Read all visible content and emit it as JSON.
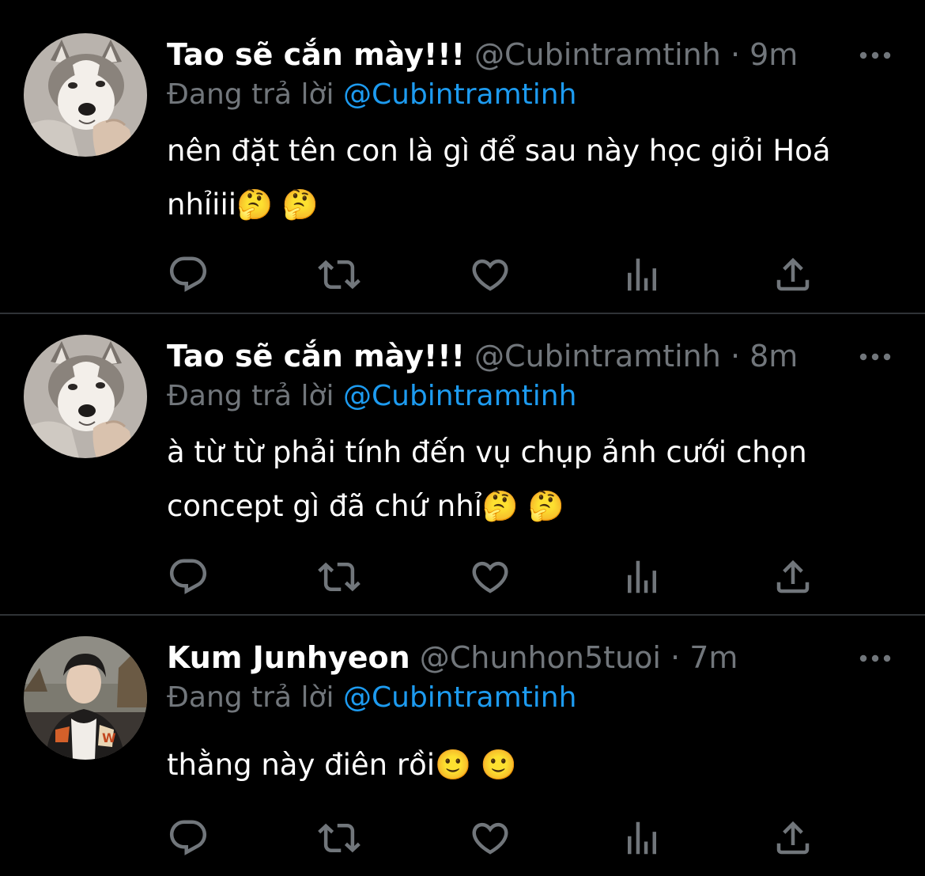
{
  "tweets": [
    {
      "display_name": "Tao sẽ cắn mày!!!",
      "handle": "@Cubintramtinh",
      "separator": "·",
      "time": "9m",
      "reply_prefix": "Đang trả lời",
      "reply_to": "@Cubintramtinh",
      "text": "nên đặt tên con là gì để sau này học giỏi Hoá nhỉiii🤔 🤔",
      "avatar_icon": "husky-dog-avatar-icon"
    },
    {
      "display_name": "Tao sẽ cắn mày!!!",
      "handle": "@Cubintramtinh",
      "separator": "·",
      "time": "8m",
      "reply_prefix": "Đang trả lời",
      "reply_to": "@Cubintramtinh",
      "text": "à từ từ phải tính đến vụ chụp ảnh cưới chọn concept gì đã chứ nhỉ🤔 🤔",
      "avatar_icon": "husky-dog-avatar-icon"
    },
    {
      "display_name": "Kum Junhyeon",
      "handle": "@Chunhon5tuoi",
      "separator": "·",
      "time": "7m",
      "reply_prefix": "Đang trả lời",
      "reply_to": "@Cubintramtinh",
      "text": "thằng này điên rồi🙂 🙂",
      "avatar_icon": "person-photo-avatar-icon"
    }
  ],
  "action_icons": [
    "reply-icon",
    "retweet-icon",
    "like-icon",
    "analytics-icon",
    "share-icon"
  ],
  "colors": {
    "background": "#000000",
    "text": "#ffffff",
    "secondary": "#71767b",
    "accent": "#1d9bf0",
    "divider": "#2f3336"
  }
}
